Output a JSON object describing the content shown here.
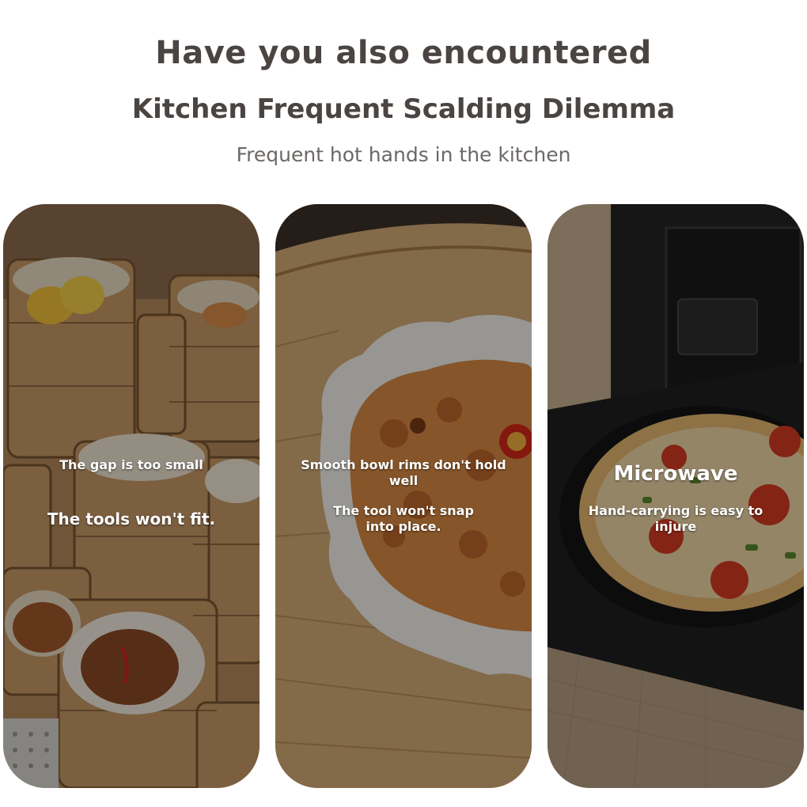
{
  "header": {
    "title": "Have you also encountered",
    "subtitle": "Kitchen Frequent Scalding Dilemma",
    "tagline": "Frequent hot hands in the kitchen"
  },
  "cards": [
    {
      "image": "bamboo-steamers-dim-sum",
      "caption_1": "The gap is too small",
      "caption_2": "The tools won't fit."
    },
    {
      "image": "steamer-with-white-bowl",
      "caption_1": "Smooth bowl rims don't hold well",
      "caption_2": "The tool won't snap into place."
    },
    {
      "image": "pizza-pan-in-oven",
      "caption_1": "Microwave",
      "caption_2": "Hand-carrying is easy to injure"
    }
  ]
}
